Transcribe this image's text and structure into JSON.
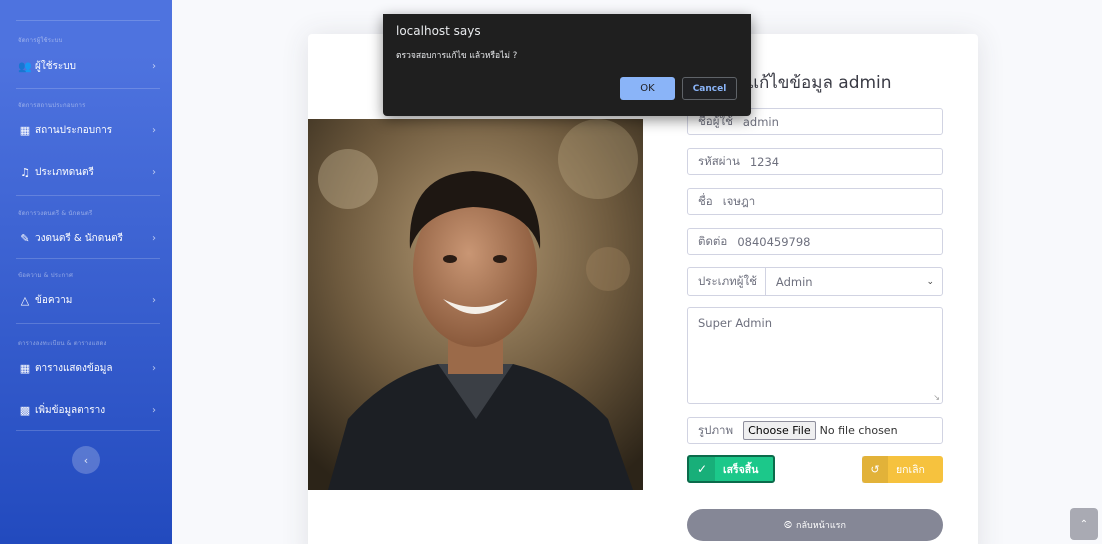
{
  "sidebar": {
    "sections": [
      {
        "heading": "จัดการผู้ใช้ระบบ",
        "items": [
          {
            "label": "ผู้ใช้ระบบ",
            "icon": "users-icon"
          }
        ]
      },
      {
        "heading": "จัดการสถานประกอบการ",
        "items": [
          {
            "label": "สถานประกอบการ",
            "icon": "store-icon"
          },
          {
            "label": "ประเภทดนตรี",
            "icon": "music-icon"
          }
        ]
      },
      {
        "heading": "จัดการวงดนตรี & นักดนตรี",
        "items": [
          {
            "label": "วงดนตรี & นักดนตรี",
            "icon": "guitar-icon"
          }
        ]
      },
      {
        "heading": "ข้อความ & ประกาศ",
        "items": [
          {
            "label": "ข้อความ",
            "icon": "inbox-icon"
          }
        ]
      },
      {
        "heading": "ตารางลงทะเบียน & ตารางแสดง",
        "items": [
          {
            "label": "ตารางแสดงข้อมูล",
            "icon": "table-icon"
          },
          {
            "label": "เพิ่มข้อมูลตาราง",
            "icon": "folder-plus-icon"
          }
        ]
      }
    ],
    "toggle_icon": "chevron-left-icon"
  },
  "form": {
    "title": "แก้ไขข้อมูล admin",
    "username": {
      "label": "ชื่อผู้ใช้",
      "value": "admin"
    },
    "password": {
      "label": "รหัสผ่าน",
      "value": "1234"
    },
    "name": {
      "label": "ชื่อ",
      "value": "เจษฎา"
    },
    "contact": {
      "label": "ติดต่อ",
      "value": "0840459798"
    },
    "user_type": {
      "label": "ประเภทผู้ใช้",
      "selected": "Admin"
    },
    "description": "Super Admin",
    "image": {
      "label": "รูปภาพ",
      "button": "Choose File",
      "status": "No file chosen"
    },
    "save_label": "เสร็จสิ้น",
    "cancel_label": "ยกเลิก",
    "home_label": "กลับหน้าแรก"
  },
  "dialog": {
    "title": "localhost says",
    "message": "ตรวจสอบการแก้ไข แล้วหรือไม่ ?",
    "ok": "OK",
    "cancel": "Cancel"
  },
  "colors": {
    "sidebar": "#4e73df",
    "success": "#1cc88a",
    "warning": "#f6c23e",
    "secondary": "#858796",
    "dialog_bg": "#1f1f1f",
    "dialog_accent": "#8ab4f8"
  }
}
